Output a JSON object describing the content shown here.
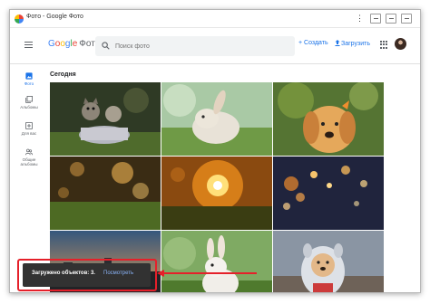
{
  "window": {
    "title": "Фото - Google Фото",
    "menu_glyph": "⋮"
  },
  "header": {
    "logo_google": [
      "G",
      "o",
      "o",
      "g",
      "l",
      "e"
    ],
    "logo_photos": "Фото",
    "search_placeholder": "Поиск фото",
    "create_label": "+ Создать",
    "upload_label": "Загрузить"
  },
  "sidebar": {
    "items": [
      {
        "label": "Фото",
        "icon": "photo-icon",
        "active": true
      },
      {
        "label": "Альбомы",
        "icon": "albums-icon"
      },
      {
        "label": "Для вас",
        "icon": "for-you-icon"
      },
      {
        "label": "Общие альбомы",
        "icon": "shared-albums-icon"
      }
    ]
  },
  "main": {
    "date_label": "Сегодня",
    "photos": [
      {
        "name": "kittens-in-basket"
      },
      {
        "name": "rabbit-on-grass"
      },
      {
        "name": "dog-with-butterfly"
      },
      {
        "name": "bokeh-lights-warm"
      },
      {
        "name": "sunset-grass"
      },
      {
        "name": "bokeh-lights-night"
      },
      {
        "name": "city-sunset"
      },
      {
        "name": "white-rabbit"
      },
      {
        "name": "dog-in-costume"
      }
    ]
  },
  "toast": {
    "text": "Загружено объектов: 3.",
    "action": "Посмотреть"
  },
  "colors": {
    "accent": "#1a73e8",
    "highlight": "#e5202a",
    "toast_bg": "#323232"
  }
}
